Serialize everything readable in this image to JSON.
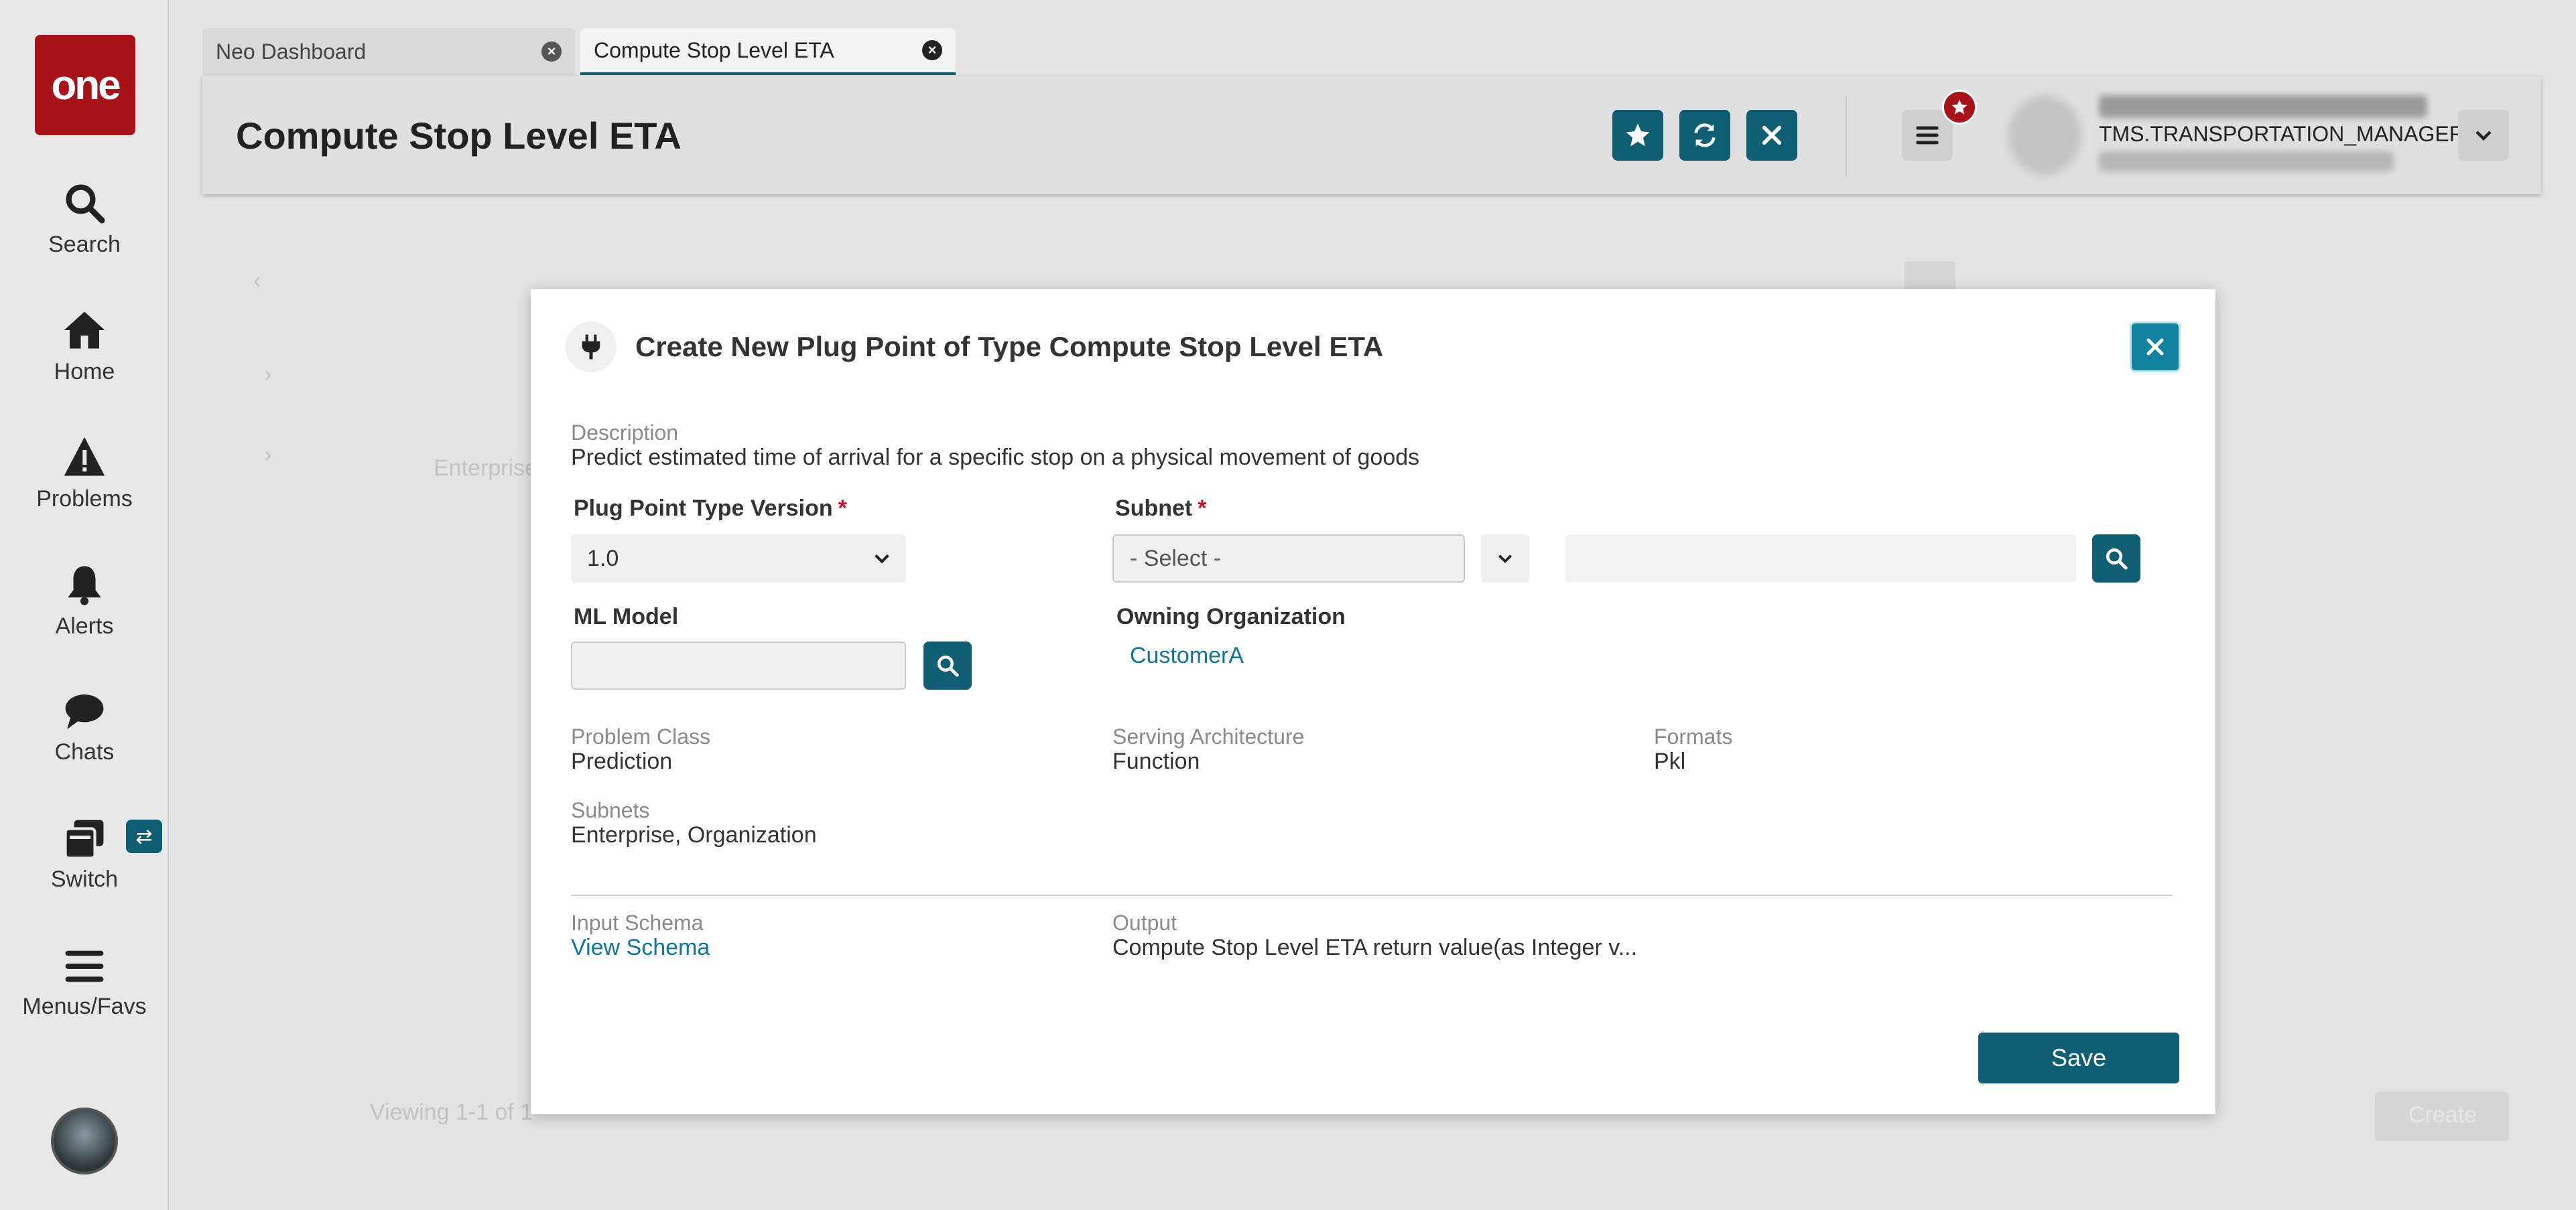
{
  "logo": {
    "text": "one"
  },
  "rail": {
    "items": [
      {
        "label": "Search"
      },
      {
        "label": "Home"
      },
      {
        "label": "Problems"
      },
      {
        "label": "Alerts"
      },
      {
        "label": "Chats"
      },
      {
        "label": "Switch"
      },
      {
        "label": "Menus/Favs"
      }
    ]
  },
  "tabs": [
    {
      "label": "Neo Dashboard"
    },
    {
      "label": "Compute Stop Level ETA"
    }
  ],
  "header": {
    "title": "Compute Stop Level ETA",
    "user_role": "TMS.TRANSPORTATION_MANAGER"
  },
  "background": {
    "viewing_text": "Viewing 1-1 of 1",
    "row_text": "Enterprise",
    "create_label": "Create"
  },
  "modal": {
    "title": "Create New Plug Point of Type Compute Stop Level ETA",
    "description_label": "Description",
    "description": "Predict estimated time of arrival for a specific stop on a physical movement of goods",
    "version_label": "Plug Point Type Version",
    "version_value": "1.0",
    "subnet_label": "Subnet",
    "subnet_placeholder": "- Select -",
    "ml_model_label": "ML Model",
    "owning_org_label": "Owning Organization",
    "owning_org_value": "CustomerA",
    "problem_class_label": "Problem Class",
    "problem_class": "Prediction",
    "serving_arch_label": "Serving Architecture",
    "serving_arch": "Function",
    "formats_label": "Formats",
    "formats": "Pkl",
    "subnets_label": "Subnets",
    "subnets": "Enterprise, Organization",
    "input_schema_label": "Input Schema",
    "view_schema": "View Schema",
    "output_label": "Output",
    "output": "Compute Stop Level ETA return value(as Integer v...",
    "save_label": "Save"
  },
  "colors": {
    "accent": "#0f5e73",
    "brand": "#a8131a",
    "close_button": "#12829e",
    "link": "#12749a"
  }
}
